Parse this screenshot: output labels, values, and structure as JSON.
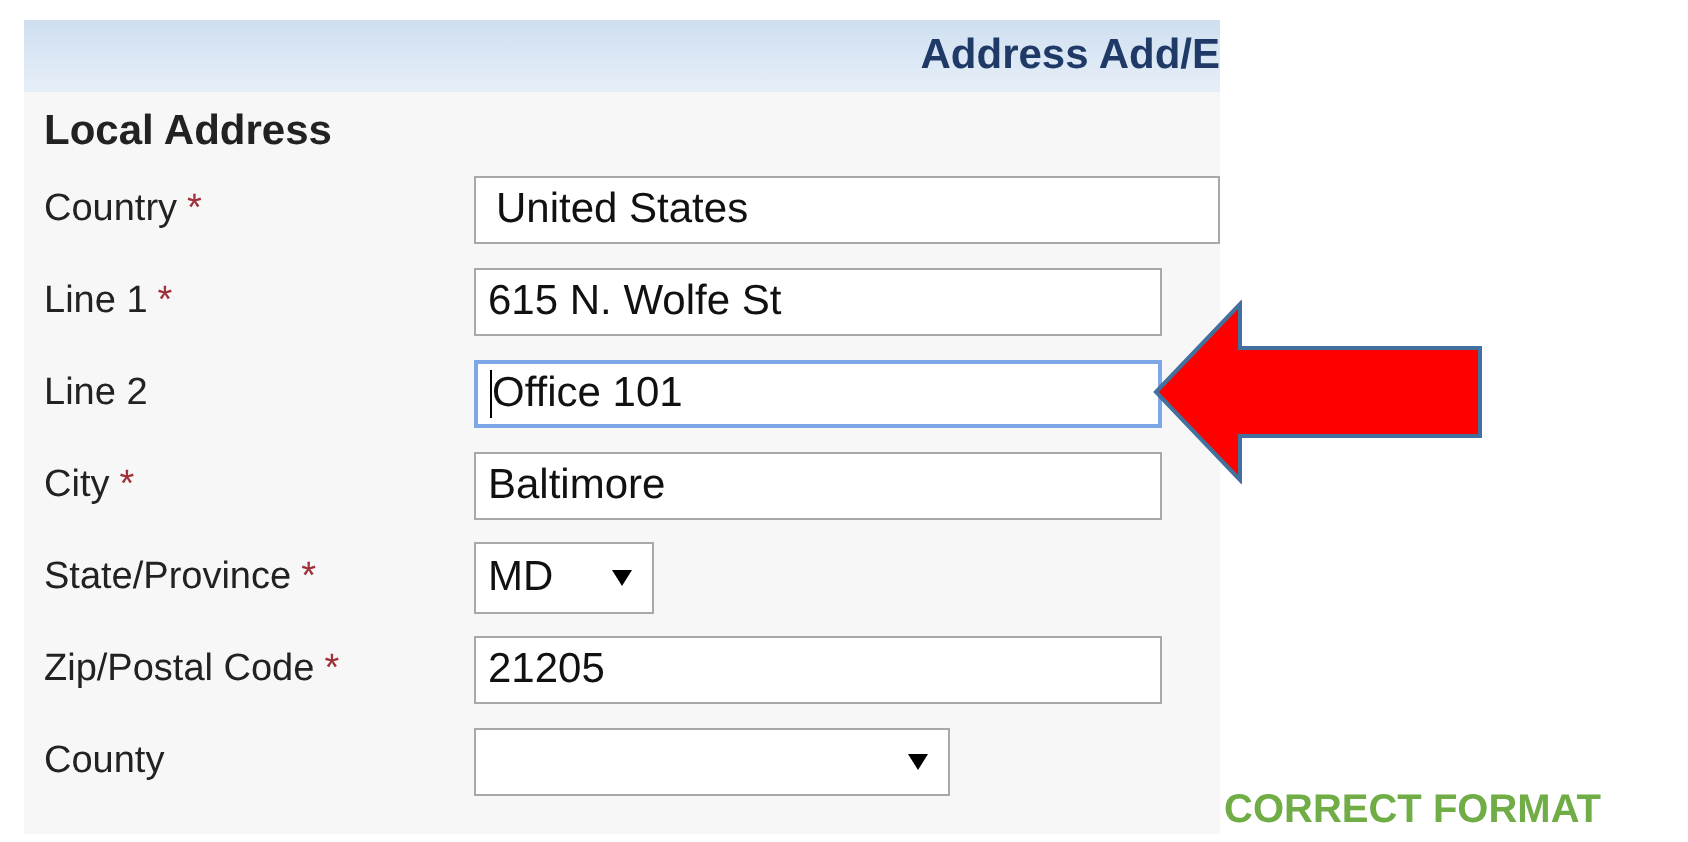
{
  "header": {
    "title": "Address Add/E"
  },
  "section": {
    "title": "Local Address"
  },
  "fields": [
    {
      "label": "Country",
      "required_mark": "*",
      "kind": "wide",
      "value": "United States",
      "focused": false
    },
    {
      "label": "Line 1",
      "required_mark": "*",
      "kind": "text",
      "value": "615 N. Wolfe St",
      "focused": false
    },
    {
      "label": "Line 2",
      "kind": "text",
      "value": "Office 101",
      "focused": true
    },
    {
      "label": "City",
      "required_mark": "*",
      "kind": "text",
      "value": "Baltimore",
      "focused": false
    },
    {
      "label": "State/Province",
      "required_mark": "*",
      "kind": "select",
      "value": "MD",
      "focused": false
    },
    {
      "label": "Zip/Postal Code",
      "required_mark": "*",
      "kind": "text",
      "value": "21205",
      "focused": false
    },
    {
      "label": "County",
      "kind": "select-wide",
      "focused": false
    }
  ],
  "caption": "CORRECT FORMAT"
}
